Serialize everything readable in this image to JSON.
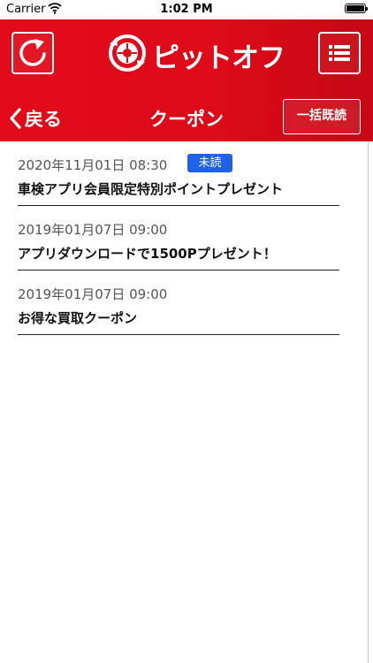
{
  "status_bar": {
    "carrier": "Carrier",
    "time": "1:02 PM"
  },
  "header": {
    "logo_text": "ピットオフ",
    "back_label": "戻る",
    "title": "クーポン",
    "mark_all_read_label": "一括既読"
  },
  "colors": {
    "brand_red": "#e30b1a",
    "badge_blue": "#1e62e8"
  },
  "icons": {
    "refresh": "refresh-icon",
    "menu": "list-menu-icon",
    "back": "chevron-left-icon",
    "logo": "tire-logo-icon"
  },
  "coupons": [
    {
      "date": "2020年11月01日 08:30",
      "badge": "未読",
      "title": "車検アプリ会員限定特別ポイントプレゼント"
    },
    {
      "date": "2019年01月07日 09:00",
      "title": "アプリダウンロードで1500Pプレゼント！"
    },
    {
      "date": "2019年01月07日 09:00",
      "title": "お得な買取クーポン"
    }
  ]
}
